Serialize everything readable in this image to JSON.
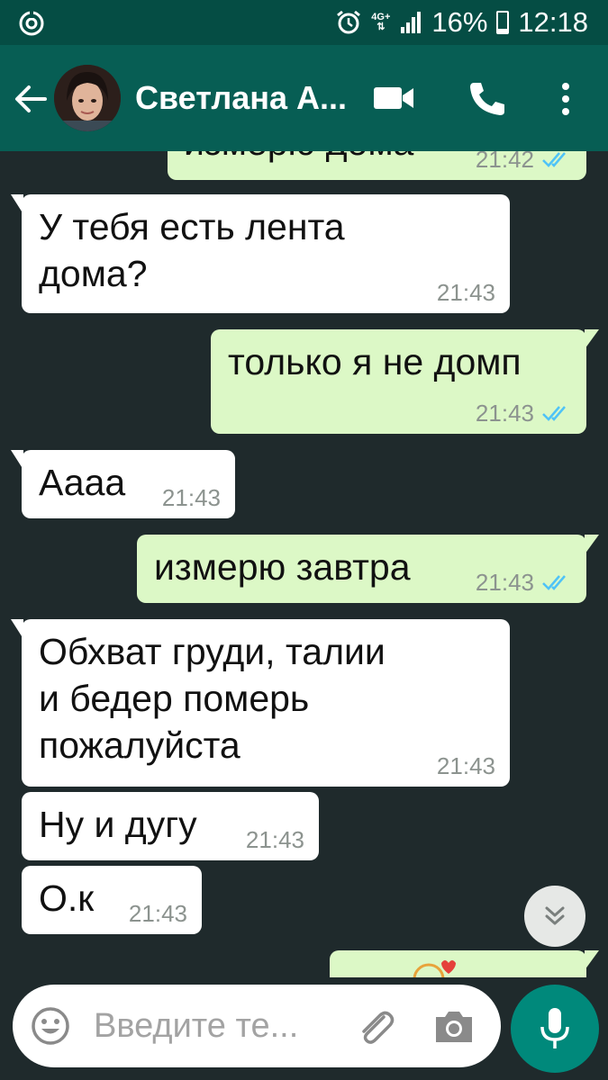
{
  "status_bar": {
    "network": "4G+",
    "battery": "16%",
    "battery_level": 0.16,
    "time": "12:18"
  },
  "header": {
    "contact_name": "Светлана А...",
    "icons": [
      "back-arrow-icon",
      "video-call-icon",
      "phone-icon",
      "more-vert-icon"
    ]
  },
  "messages": [
    {
      "direction": "out",
      "text": "измерю дома",
      "time": "21:42",
      "ticks": "read"
    },
    {
      "direction": "in",
      "text": "У тебя есть лента\nдома?",
      "time": "21:43"
    },
    {
      "direction": "out",
      "text": "только я не домп",
      "time": "21:43",
      "ticks": "read"
    },
    {
      "direction": "in",
      "text": "Аааа",
      "time": "21:43"
    },
    {
      "direction": "out",
      "text": "измерю завтра",
      "time": "21:43",
      "ticks": "read"
    },
    {
      "direction": "in",
      "text": "Обхват груди, талии\nи бедер померь\nпожалуйста",
      "time": "21:43"
    },
    {
      "direction": "in",
      "text": "Ну и дугу",
      "time": "21:43"
    },
    {
      "direction": "in",
      "text": "О.к",
      "time": "21:43"
    }
  ],
  "composer": {
    "placeholder": "Введите те..."
  },
  "colors": {
    "header": "#075e54",
    "status_bar": "#054d44",
    "outgoing_bubble": "#dcf8c6",
    "incoming_bubble": "#ffffff",
    "read_ticks": "#4fc3f7",
    "mic_button": "#00897b"
  }
}
